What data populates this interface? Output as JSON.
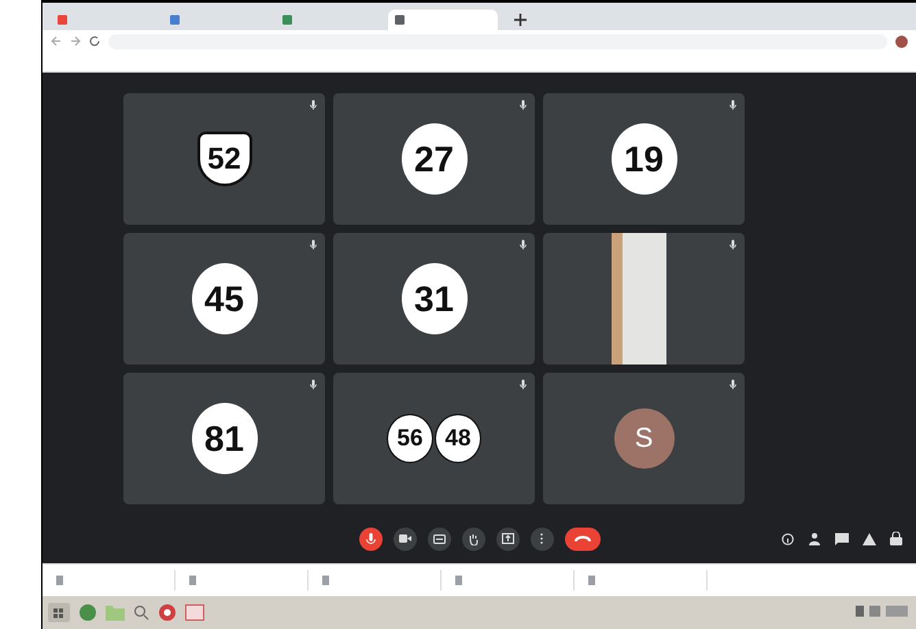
{
  "browser": {
    "tabs": [
      {
        "selected": false
      },
      {
        "selected": false
      },
      {
        "selected": false
      },
      {
        "selected": true
      }
    ]
  },
  "tiles": [
    {
      "kind": "shield",
      "numbers": [
        "52"
      ]
    },
    {
      "kind": "number",
      "numbers": [
        "27"
      ]
    },
    {
      "kind": "number",
      "numbers": [
        "19"
      ]
    },
    {
      "kind": "number",
      "numbers": [
        "45"
      ]
    },
    {
      "kind": "number",
      "numbers": [
        "31"
      ]
    },
    {
      "kind": "video"
    },
    {
      "kind": "number",
      "numbers": [
        "81"
      ]
    },
    {
      "kind": "number",
      "numbers": [
        "56",
        "48"
      ]
    },
    {
      "kind": "letter",
      "letter": "S"
    }
  ],
  "call_controls": {
    "mic_muted": true
  }
}
